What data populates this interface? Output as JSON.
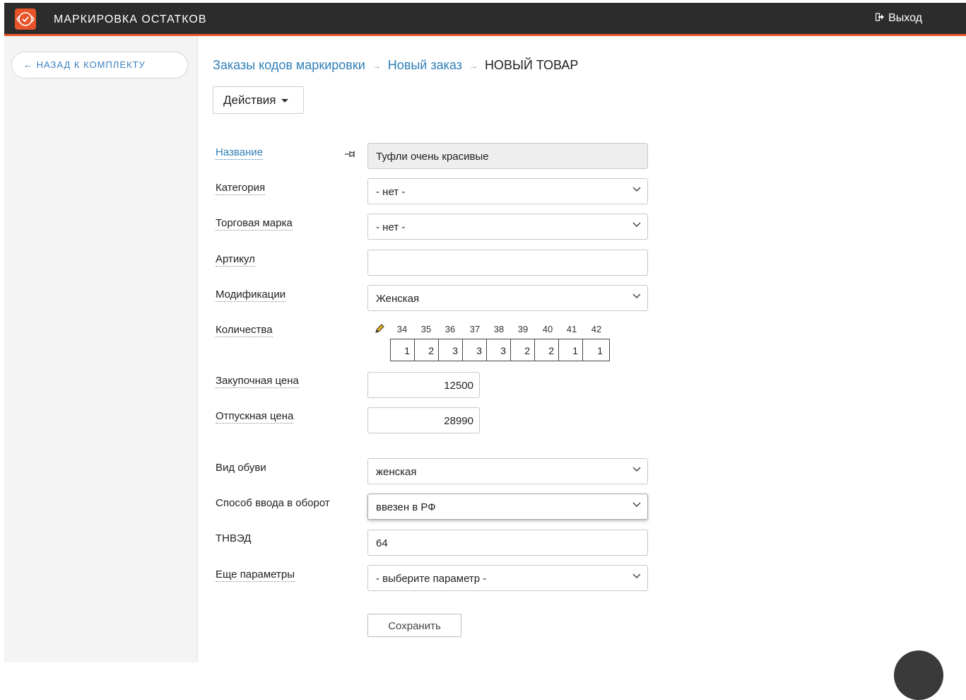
{
  "header": {
    "app_title": "МАРКИРОВКА ОСТАТКОВ",
    "logout_label": "Выход"
  },
  "sidebar": {
    "back_label": "← НАЗАД К КОМПЛЕКТУ"
  },
  "breadcrumb": {
    "items": [
      "Заказы кодов маркировки",
      "Новый заказ"
    ],
    "current": "НОВЫЙ ТОВАР",
    "separator": "→"
  },
  "actions_label": "Действия",
  "form": {
    "name": {
      "label": "Название",
      "value": "Туфли очень красивые"
    },
    "category": {
      "label": "Категория",
      "value": "- нет -"
    },
    "brand": {
      "label": "Торговая марка",
      "value": "- нет -"
    },
    "article": {
      "label": "Артикул",
      "value": ""
    },
    "modifications": {
      "label": "Модификации",
      "value": "Женская"
    },
    "quantities": {
      "label": "Количества",
      "sizes": [
        "34",
        "35",
        "36",
        "37",
        "38",
        "39",
        "40",
        "41",
        "42"
      ],
      "values": [
        "1",
        "2",
        "3",
        "3",
        "3",
        "2",
        "2",
        "1",
        "1"
      ]
    },
    "purchase_price": {
      "label": "Закупочная цена",
      "value": "12500"
    },
    "sale_price": {
      "label": "Отпускная цена",
      "value": "28990"
    },
    "shoe_type": {
      "label": "Вид обуви",
      "value": "женская"
    },
    "circulation": {
      "label": "Способ ввода в оборот",
      "value": "ввезен в РФ"
    },
    "tnved": {
      "label": "ТНВЭД",
      "value": "64"
    },
    "more_params": {
      "label": "Еще параметры",
      "value": "- выберите параметр -"
    },
    "save_label": "Сохранить"
  },
  "colors": {
    "accent": "#e8542a",
    "topbar": "#2c2c2c",
    "link": "#2f7fb6"
  }
}
